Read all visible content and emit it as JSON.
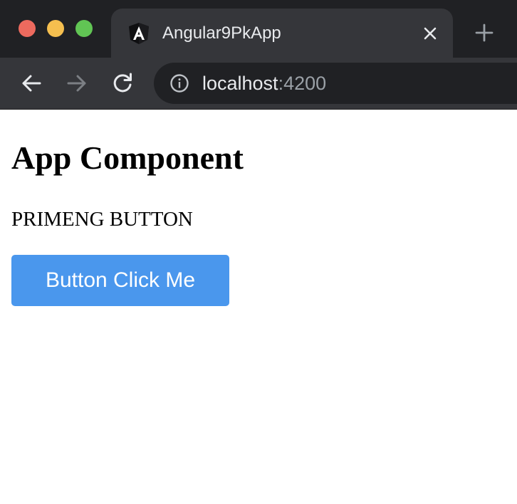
{
  "browser": {
    "tab": {
      "title": "Angular9PkApp",
      "favicon": "angular-icon"
    },
    "address_bar": {
      "host": "localhost",
      "port": ":4200"
    },
    "icons": {
      "back": "back-arrow-icon",
      "forward": "forward-arrow-icon",
      "reload": "reload-icon",
      "info": "info-icon",
      "close": "close-icon",
      "new_tab": "plus-icon"
    },
    "colors": {
      "traffic_red": "#ed6a5e",
      "traffic_yellow": "#f5bf4f",
      "traffic_green": "#61c554"
    }
  },
  "page": {
    "title": "App Component",
    "section_label": "PRIMENG BUTTON",
    "button_label": "Button Click Me",
    "button_color": "#4a97ed"
  }
}
